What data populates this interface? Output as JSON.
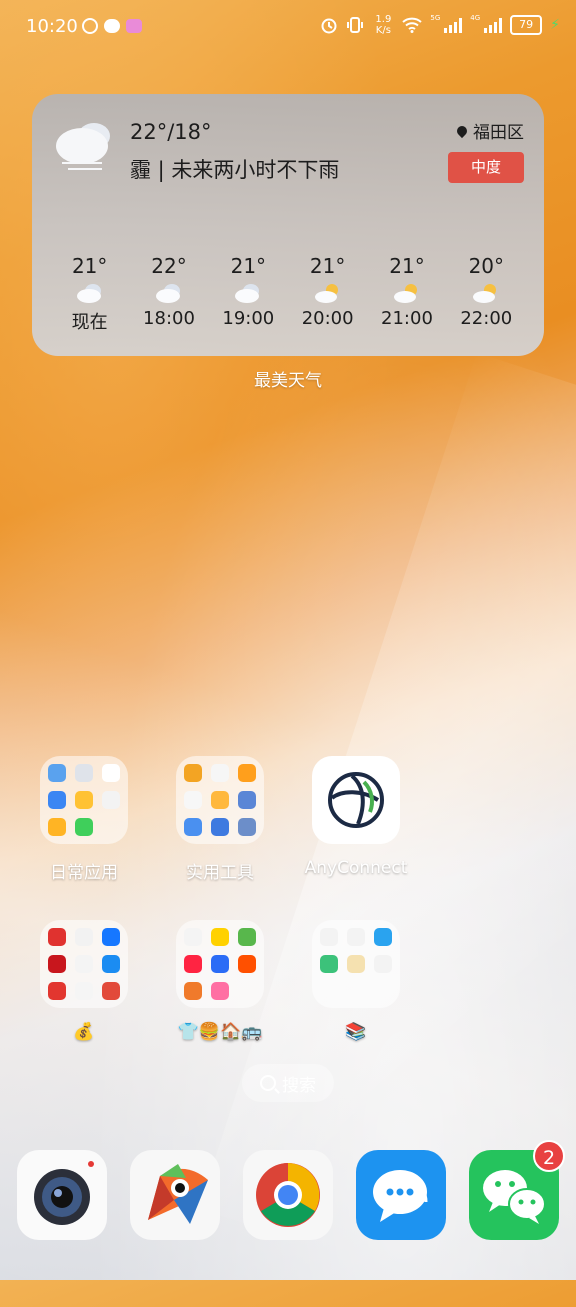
{
  "status_bar": {
    "time": "10:20",
    "speed": "1.9\nK/s",
    "signal_tag_1": "5G",
    "signal_tag_2": "4G",
    "battery": "79"
  },
  "weather": {
    "range": "22°/18°",
    "description": "霾 | 未来两小时不下雨",
    "location": "福田区",
    "aqi": "中度",
    "hours": [
      {
        "temp": "21°",
        "time": "现在",
        "icon": "cloudy-icon"
      },
      {
        "temp": "22°",
        "time": "18:00",
        "icon": "cloudy-icon"
      },
      {
        "temp": "21°",
        "time": "19:00",
        "icon": "cloudy-icon"
      },
      {
        "temp": "21°",
        "time": "20:00",
        "icon": "partly-sunny-icon"
      },
      {
        "temp": "21°",
        "time": "21:00",
        "icon": "partly-sunny-icon"
      },
      {
        "temp": "20°",
        "time": "22:00",
        "icon": "partly-sunny-icon"
      }
    ],
    "widget_label": "最美天气"
  },
  "apps": {
    "folder_daily": "日常应用",
    "folder_tools": "实用工具",
    "anyconnect": "AnyConnect",
    "folder_money": "💰",
    "folder_life": "👕🍔🏠🚌",
    "folder_books": "📚"
  },
  "search": {
    "label": "搜索"
  },
  "dock": {
    "wechat_badge": "2",
    "apps": [
      "camera-app",
      "browser-bird-app",
      "chrome-app",
      "messages-app",
      "wechat-app"
    ]
  }
}
